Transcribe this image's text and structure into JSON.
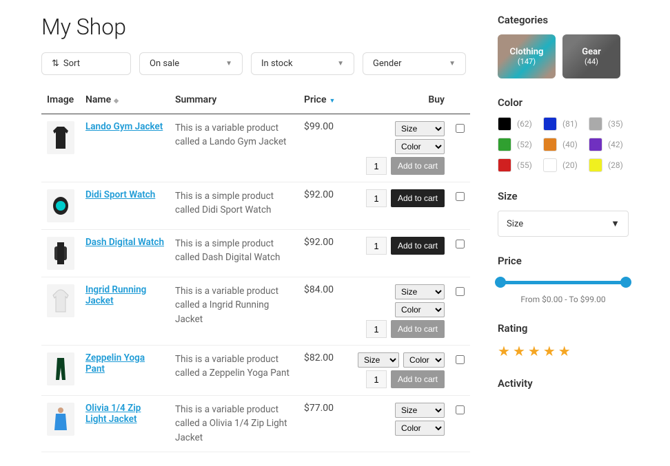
{
  "title": "My Shop",
  "filters": {
    "sort": "Sort",
    "onsale": "On sale",
    "instock": "In stock",
    "gender": "Gender"
  },
  "headers": {
    "image": "Image",
    "name": "Name",
    "summary": "Summary",
    "price": "Price",
    "buy": "Buy"
  },
  "variant_labels": {
    "size": "Size",
    "color": "Color"
  },
  "qty_default": "1",
  "add_label": "Add to cart",
  "products": [
    {
      "name": "Lando Gym Jacket",
      "summary": "This is a variable product called a Lando Gym Jacket",
      "price": "$99.00",
      "variable": true,
      "thumb_bg": "#222",
      "thumb_shape": "jacket"
    },
    {
      "name": "Didi Sport Watch",
      "summary": "This is a simple product called Didi Sport Watch",
      "price": "$92.00",
      "variable": false,
      "thumb_bg": "#111",
      "thumb_shape": "watch"
    },
    {
      "name": "Dash Digital Watch",
      "summary": "This is a simple product called Dash Digital Watch",
      "price": "$92.00",
      "variable": false,
      "thumb_bg": "#333",
      "thumb_shape": "watch2"
    },
    {
      "name": "Ingrid Running Jacket",
      "summary": "This is a variable product called a Ingrid Running Jacket",
      "price": "$84.00",
      "variable": true,
      "thumb_bg": "#eee",
      "thumb_shape": "hoodie"
    },
    {
      "name": "Zeppelin Yoga Pant",
      "summary": "This is a variable product called a Zeppelin Yoga Pant",
      "price": "$82.00",
      "variable": true,
      "thumb_bg": "#0a4020",
      "thumb_shape": "pants",
      "inline_variants": true
    },
    {
      "name": "Olivia 1/4 Zip Light Jacket",
      "summary": "This is a variable product called a Olivia 1/4 Zip Light Jacket",
      "price": "$77.00",
      "variable": true,
      "thumb_bg": "#3090e0",
      "thumb_shape": "zip"
    }
  ],
  "sidebar": {
    "categories_h": "Categories",
    "categories": [
      {
        "label": "Clothing",
        "count": "(147)",
        "cls": "clothing"
      },
      {
        "label": "Gear",
        "count": "(44)",
        "cls": "gear"
      }
    ],
    "color_h": "Color",
    "colors": [
      {
        "hex": "#000000",
        "count": "(62)"
      },
      {
        "hex": "#1030d0",
        "count": "(81)"
      },
      {
        "hex": "#aaaaaa",
        "count": "(35)"
      },
      {
        "hex": "#30a030",
        "count": "(52)"
      },
      {
        "hex": "#e08020",
        "count": "(40)"
      },
      {
        "hex": "#7030c0",
        "count": "(42)"
      },
      {
        "hex": "#d02020",
        "count": "(55)"
      },
      {
        "hex": "#ffffff",
        "count": "(20)"
      },
      {
        "hex": "#f0f020",
        "count": "(28)"
      }
    ],
    "size_h": "Size",
    "size_placeholder": "Size",
    "price_h": "Price",
    "price_label": "From $0.00 - To $99.00",
    "rating_h": "Rating",
    "activity_h": "Activity"
  }
}
